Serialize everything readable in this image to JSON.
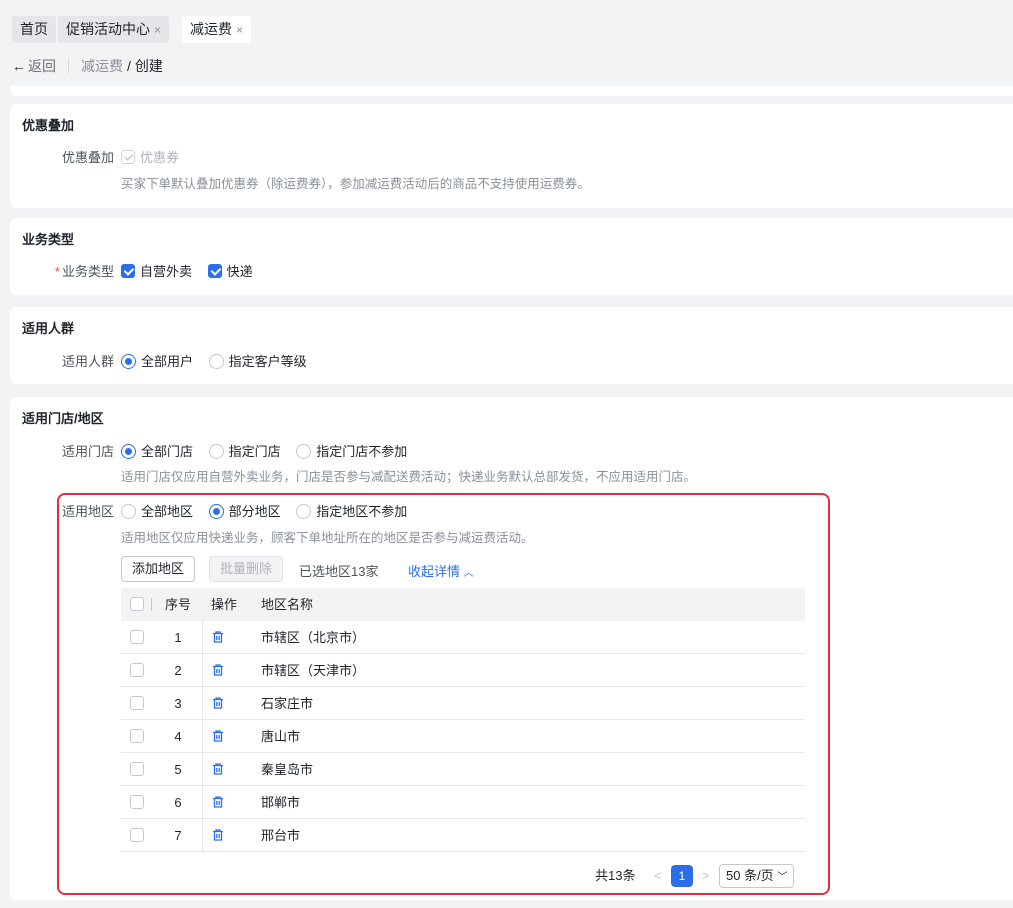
{
  "tabs": [
    {
      "label": "首页",
      "closable": false
    },
    {
      "label": "促销活动中心",
      "closable": true
    },
    {
      "label": "减运费",
      "closable": true,
      "active": true
    }
  ],
  "close_glyph": "×",
  "breadcrumb": {
    "back": "返回",
    "parent": "减运费",
    "separator": "/",
    "current": "创建"
  },
  "discount_stack": {
    "title": "优惠叠加",
    "label": "优惠叠加",
    "option": "优惠券",
    "hint": "买家下单默认叠加优惠券（除运费券），参加减运费活动后的商品不支持使用运费券。"
  },
  "business_type": {
    "title": "业务类型",
    "required_mark": "*",
    "label": "业务类型",
    "options": [
      "自营外卖",
      "快递"
    ]
  },
  "audience": {
    "title": "适用人群",
    "label": "适用人群",
    "options": [
      "全部用户",
      "指定客户等级"
    ],
    "selected": "全部用户"
  },
  "store_region": {
    "title": "适用门店/地区",
    "store_label": "适用门店",
    "store_options": [
      "全部门店",
      "指定门店",
      "指定门店不参加"
    ],
    "store_selected": "全部门店",
    "store_hint": "适用门店仅应用自营外卖业务，门店是否参与减配送费活动；快递业务默认总部发货，不应用适用门店。",
    "region_label": "适用地区",
    "region_options": [
      "全部地区",
      "部分地区",
      "指定地区不参加"
    ],
    "region_selected": "部分地区",
    "region_hint": "适用地区仅应用快递业务，顾客下单地址所在的地区是否参与减运费活动。",
    "add_button": "添加地区",
    "batch_delete_button": "批量删除",
    "selected_count": "已选地区13家",
    "collapse_link": "收起详情"
  },
  "table": {
    "headers": {
      "index": "序号",
      "action": "操作",
      "name": "地区名称"
    },
    "rows": [
      {
        "index": "1",
        "name": "市辖区（北京市）"
      },
      {
        "index": "2",
        "name": "市辖区（天津市）"
      },
      {
        "index": "3",
        "name": "石家庄市"
      },
      {
        "index": "4",
        "name": "唐山市"
      },
      {
        "index": "5",
        "name": "秦皇岛市"
      },
      {
        "index": "6",
        "name": "邯郸市"
      },
      {
        "index": "7",
        "name": "邢台市"
      }
    ]
  },
  "pagination": {
    "total": "共13条",
    "prev": "<",
    "page": "1",
    "next": ">",
    "page_size": "50 条/页"
  },
  "colors": {
    "accent": "#2a6fe8",
    "highlight_box": "#e0303a",
    "required": "#e04a3f"
  },
  "icons": [
    "arrow-left-icon",
    "close-icon",
    "checkbox-icon",
    "radio-icon",
    "trash-icon",
    "chevron-up-icon",
    "chevron-down-icon"
  ]
}
